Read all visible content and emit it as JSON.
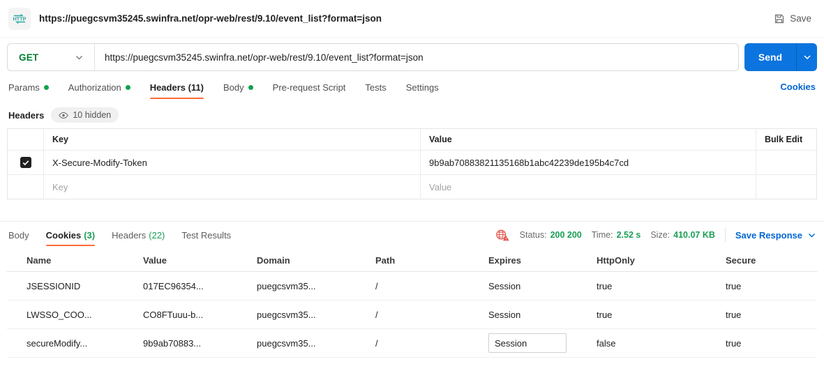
{
  "topbar": {
    "title": "https://puegcsvm35245.swinfra.net/opr-web/rest/9.10/event_list?format=json",
    "save_label": "Save"
  },
  "request": {
    "method": "GET",
    "url": "https://puegcsvm35245.swinfra.net/opr-web/rest/9.10/event_list?format=json",
    "send_label": "Send",
    "tabs": [
      {
        "label": "Params",
        "dot": true
      },
      {
        "label": "Authorization",
        "dot": true
      },
      {
        "label": "Headers (11)",
        "active": true
      },
      {
        "label": "Body",
        "dot": true
      },
      {
        "label": "Pre-request Script"
      },
      {
        "label": "Tests"
      },
      {
        "label": "Settings"
      }
    ],
    "cookies_link": "Cookies"
  },
  "headers_section": {
    "title": "Headers",
    "hidden_badge": "10 hidden",
    "columns": {
      "key": "Key",
      "value": "Value",
      "bulk_edit": "Bulk Edit"
    },
    "rows": [
      {
        "checked": true,
        "key": "X-Secure-Modify-Token",
        "value": "9b9ab70883821135168b1abc42239de195b4c7cd"
      }
    ],
    "placeholder_key": "Key",
    "placeholder_value": "Value"
  },
  "response": {
    "tabs": [
      {
        "label": "Body"
      },
      {
        "label": "Cookies",
        "count": "(3)",
        "active": true
      },
      {
        "label": "Headers",
        "count": "(22)"
      },
      {
        "label": "Test Results"
      }
    ],
    "status_label": "Status:",
    "status_value": "200 200",
    "time_label": "Time:",
    "time_value": "2.52 s",
    "size_label": "Size:",
    "size_value": "410.07 KB",
    "save_response_label": "Save Response",
    "cookies_table": {
      "columns": [
        "Name",
        "Value",
        "Domain",
        "Path",
        "Expires",
        "HttpOnly",
        "Secure"
      ],
      "rows": [
        [
          "JSESSIONID",
          "017EC96354...",
          "puegcsvm35...",
          "/",
          "Session",
          "true",
          "true"
        ],
        [
          "LWSSO_COO...",
          "CO8FTuuu-b...",
          "puegcsvm35...",
          "/",
          "Session",
          "true",
          "true"
        ],
        [
          "secureModify...",
          "9b9ab70883...",
          "puegcsvm35...",
          "/",
          "Session",
          "false",
          "true"
        ]
      ]
    }
  },
  "colors": {
    "method_green": "#007f31",
    "count_green": "#1a9e55",
    "accent_orange": "#ff6c37",
    "link_blue": "#0265d2",
    "send_blue": "#0b74de",
    "error_red": "#e2574c",
    "checkbox_dark": "#212121"
  }
}
